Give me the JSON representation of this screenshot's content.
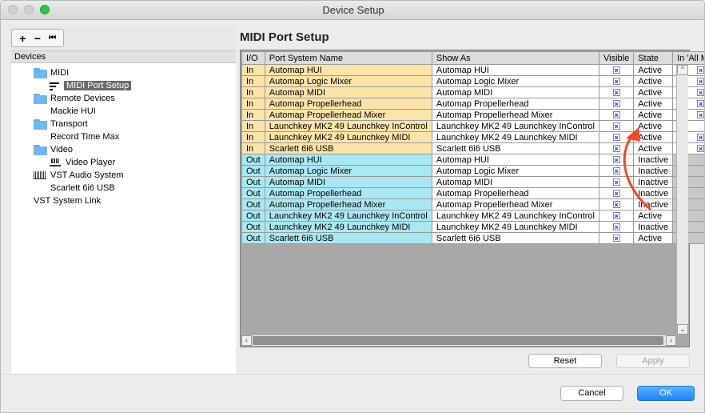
{
  "window": {
    "title": "Device Setup"
  },
  "toolbar": {
    "add": "+",
    "remove": "−",
    "reset": "⏮"
  },
  "devices": {
    "header": "Devices",
    "items": [
      {
        "label": "MIDI",
        "icon": "folder-icon"
      },
      {
        "label": "MIDI Port Setup",
        "icon": "midi-port-icon",
        "selected": true
      },
      {
        "label": "Remote Devices",
        "icon": "folder-icon"
      },
      {
        "label": "Mackie HUI",
        "icon": "none"
      },
      {
        "label": "Transport",
        "icon": "folder-icon"
      },
      {
        "label": "Record Time Max",
        "icon": "none"
      },
      {
        "label": "Video",
        "icon": "folder-icon"
      },
      {
        "label": "Video Player",
        "icon": "video-player-icon"
      },
      {
        "label": "VST Audio System",
        "icon": "vst-audio-icon"
      },
      {
        "label": "Scarlett 6i6 USB",
        "icon": "none"
      },
      {
        "label": "VST System Link",
        "icon": "none"
      }
    ]
  },
  "panel": {
    "title": "MIDI Port Setup",
    "columns": [
      "I/O",
      "Port System Name",
      "Show As",
      "Visible",
      "State",
      "In 'All MIDI I"
    ],
    "rows": [
      {
        "io": "In",
        "name": "Automap HUI",
        "show_as": "Automap HUI",
        "visible": true,
        "state": "Active",
        "all_midi": true
      },
      {
        "io": "In",
        "name": "Automap Logic Mixer",
        "show_as": "Automap Logic Mixer",
        "visible": true,
        "state": "Active",
        "all_midi": true
      },
      {
        "io": "In",
        "name": "Automap MIDI",
        "show_as": "Automap MIDI",
        "visible": true,
        "state": "Active",
        "all_midi": true
      },
      {
        "io": "In",
        "name": "Automap Propellerhead",
        "show_as": "Automap Propellerhead",
        "visible": true,
        "state": "Active",
        "all_midi": true
      },
      {
        "io": "In",
        "name": "Automap Propellerhead Mixer",
        "show_as": "Automap Propellerhead Mixer",
        "visible": true,
        "state": "Active",
        "all_midi": true
      },
      {
        "io": "In",
        "name": "Launchkey MK2 49 Launchkey InControl",
        "show_as": "Launchkey MK2 49 Launchkey InControl",
        "visible": true,
        "state": "Active",
        "all_midi": false
      },
      {
        "io": "In",
        "name": "Launchkey MK2 49 Launchkey MIDI",
        "show_as": "Launchkey MK2 49 Launchkey MIDI",
        "visible": true,
        "state": "Active",
        "all_midi": true
      },
      {
        "io": "In",
        "name": "Scarlett 6i6 USB",
        "show_as": "Scarlett 6i6 USB",
        "visible": true,
        "state": "Active",
        "all_midi": true
      },
      {
        "io": "Out",
        "name": "Automap HUI",
        "show_as": "Automap HUI",
        "visible": true,
        "state": "Inactive",
        "all_midi": null
      },
      {
        "io": "Out",
        "name": "Automap Logic Mixer",
        "show_as": "Automap Logic Mixer",
        "visible": true,
        "state": "Inactive",
        "all_midi": null
      },
      {
        "io": "Out",
        "name": "Automap MIDI",
        "show_as": "Automap MIDI",
        "visible": true,
        "state": "Inactive",
        "all_midi": null
      },
      {
        "io": "Out",
        "name": "Automap Propellerhead",
        "show_as": "Automap Propellerhead",
        "visible": true,
        "state": "Inactive",
        "all_midi": null
      },
      {
        "io": "Out",
        "name": "Automap Propellerhead Mixer",
        "show_as": "Automap Propellerhead Mixer",
        "visible": true,
        "state": "Inactive",
        "all_midi": null
      },
      {
        "io": "Out",
        "name": "Launchkey MK2 49 Launchkey InControl",
        "show_as": "Launchkey MK2 49 Launchkey InControl",
        "visible": true,
        "state": "Active",
        "all_midi": null
      },
      {
        "io": "Out",
        "name": "Launchkey MK2 49 Launchkey MIDI",
        "show_as": "Launchkey MK2 49 Launchkey MIDI",
        "visible": true,
        "state": "Inactive",
        "all_midi": null
      },
      {
        "io": "Out",
        "name": "Scarlett 6i6 USB",
        "show_as": "Scarlett 6i6 USB",
        "visible": true,
        "state": "Active",
        "all_midi": null
      }
    ]
  },
  "buttons": {
    "reset": "Reset",
    "apply": "Apply",
    "cancel": "Cancel",
    "ok": "OK"
  },
  "colors": {
    "in_row": "#fce4a8",
    "out_row": "#a9e8f2",
    "annotation_arrow": "#f04a2a",
    "accent": "#1b84f7"
  }
}
